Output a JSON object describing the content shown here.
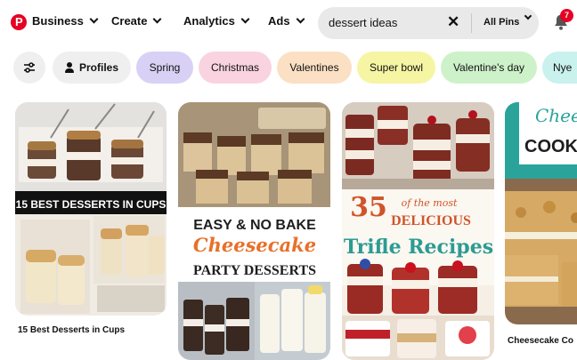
{
  "header": {
    "nav": [
      {
        "label": "Business"
      },
      {
        "label": "Create"
      },
      {
        "label": "Analytics"
      },
      {
        "label": "Ads"
      }
    ],
    "search": {
      "value": "dessert ideas",
      "scope": "All Pins"
    },
    "notifications_count": "7"
  },
  "filters": [
    {
      "label": "Profiles"
    },
    {
      "label": "Spring",
      "color": "#d8d1f5"
    },
    {
      "label": "Christmas",
      "color": "#f9d3e0"
    },
    {
      "label": "Valentines",
      "color": "#fbe0c4"
    },
    {
      "label": "Super bowl",
      "color": "#f6f5a3"
    },
    {
      "label": "Valentine's day",
      "color": "#cdf2c9"
    },
    {
      "label": "Nye",
      "color": "#c9f1ee"
    }
  ],
  "pins": [
    {
      "overlay": "15 BEST DESSERTS IN CUPS",
      "caption": "15 Best Desserts in Cups"
    },
    {
      "lines": [
        "EASY & NO BAKE",
        "Cheesecake",
        "PARTY DESSERTS"
      ]
    },
    {
      "lines": [
        "35",
        "of the most",
        "DELICIOUS",
        "Trifle Recipes"
      ]
    },
    {
      "lines": [
        "Chees",
        "COOKIN"
      ],
      "caption": "Cheesecake Co"
    }
  ],
  "colors": {
    "brand": "#e60023",
    "accent_teal": "#2aa39b"
  }
}
